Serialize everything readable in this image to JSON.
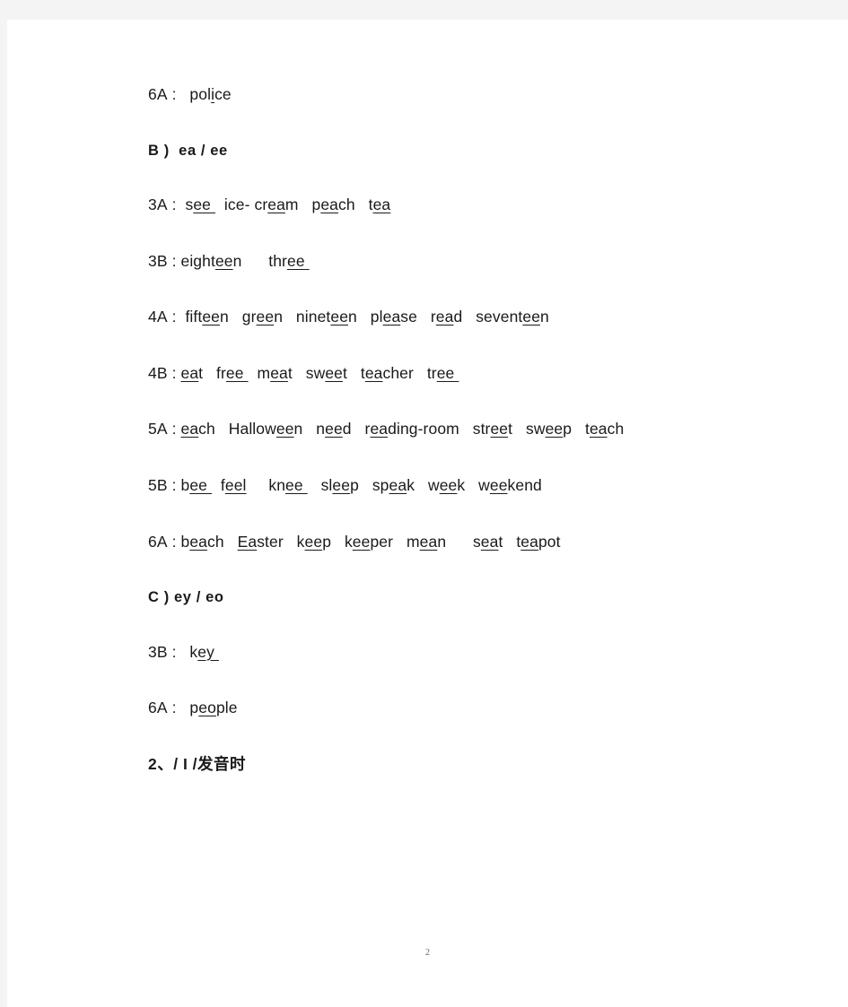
{
  "page": {
    "number": "2",
    "background_color": "#f4f4f4",
    "paper_color": "#ffffff",
    "text_color": "#1a1a1a"
  },
  "blocks": [
    {
      "id": "line-6a-police",
      "type": "entry",
      "label": "6A :",
      "text": "police",
      "segments": [
        {
          "t": "6A :",
          "u": false
        },
        {
          "t": "   ",
          "u": false
        },
        {
          "t": "pol",
          "u": false
        },
        {
          "t": "i",
          "u": true
        },
        {
          "t": "ce",
          "u": false
        }
      ]
    },
    {
      "id": "heading-b",
      "type": "heading",
      "text": "B ) ea / ee",
      "segments": [
        {
          "t": "B )",
          "u": false
        },
        {
          "t": "  ",
          "u": false
        },
        {
          "t": "ea / ee",
          "u": false
        }
      ]
    },
    {
      "id": "line-3a-ea-ee",
      "type": "entry",
      "label": "3A :",
      "text": "see  ice- cream  peach  tea",
      "segments": [
        {
          "t": "3A :",
          "u": false
        },
        {
          "t": "  ",
          "u": false
        },
        {
          "t": "s",
          "u": false
        },
        {
          "t": "ee ",
          "u": true
        },
        {
          "t": "  ",
          "u": false
        },
        {
          "t": "ice- cr",
          "u": false
        },
        {
          "t": "ea",
          "u": true
        },
        {
          "t": "m",
          "u": false
        },
        {
          "t": "   ",
          "u": false
        },
        {
          "t": "p",
          "u": false
        },
        {
          "t": "ea",
          "u": true
        },
        {
          "t": "ch",
          "u": false
        },
        {
          "t": "   ",
          "u": false
        },
        {
          "t": "t",
          "u": false
        },
        {
          "t": "ea",
          "u": true
        }
      ]
    },
    {
      "id": "line-3b-ea-ee",
      "type": "entry",
      "label": "3B :",
      "text": "eighteen   three",
      "segments": [
        {
          "t": "3B : eight",
          "u": false
        },
        {
          "t": "ee",
          "u": true
        },
        {
          "t": "n",
          "u": false
        },
        {
          "t": "      ",
          "u": false
        },
        {
          "t": "thr",
          "u": false
        },
        {
          "t": "ee ",
          "u": true
        }
      ]
    },
    {
      "id": "line-4a-ea-ee",
      "type": "entry",
      "label": "4A :",
      "text": "fifteen  green  nineteen  please  read  seventeen",
      "segments": [
        {
          "t": "4A :",
          "u": false
        },
        {
          "t": "  ",
          "u": false
        },
        {
          "t": "fift",
          "u": false
        },
        {
          "t": "ee",
          "u": true
        },
        {
          "t": "n",
          "u": false
        },
        {
          "t": "   ",
          "u": false
        },
        {
          "t": "gr",
          "u": false
        },
        {
          "t": "ee",
          "u": true
        },
        {
          "t": "n",
          "u": false
        },
        {
          "t": "   ",
          "u": false
        },
        {
          "t": "ninet",
          "u": false
        },
        {
          "t": "ee",
          "u": true
        },
        {
          "t": "n",
          "u": false
        },
        {
          "t": "   ",
          "u": false
        },
        {
          "t": "pl",
          "u": false
        },
        {
          "t": "ea",
          "u": true
        },
        {
          "t": "se",
          "u": false
        },
        {
          "t": "   ",
          "u": false
        },
        {
          "t": "r",
          "u": false
        },
        {
          "t": "ea",
          "u": true
        },
        {
          "t": "d",
          "u": false
        },
        {
          "t": "   ",
          "u": false
        },
        {
          "t": "sevent",
          "u": false
        },
        {
          "t": "ee",
          "u": true
        },
        {
          "t": "n",
          "u": false
        }
      ]
    },
    {
      "id": "line-4b-ea-ee",
      "type": "entry",
      "label": "4B :",
      "text": "eat  free  meat  sweet  teacher  tree",
      "segments": [
        {
          "t": "4B : ",
          "u": false
        },
        {
          "t": "ea",
          "u": true
        },
        {
          "t": "t",
          "u": false
        },
        {
          "t": "   ",
          "u": false
        },
        {
          "t": "fr",
          "u": false
        },
        {
          "t": "ee ",
          "u": true
        },
        {
          "t": "  ",
          "u": false
        },
        {
          "t": "m",
          "u": false
        },
        {
          "t": "ea",
          "u": true
        },
        {
          "t": "t",
          "u": false
        },
        {
          "t": "   ",
          "u": false
        },
        {
          "t": "sw",
          "u": false
        },
        {
          "t": "ee",
          "u": true
        },
        {
          "t": "t",
          "u": false
        },
        {
          "t": "   ",
          "u": false
        },
        {
          "t": "t",
          "u": false
        },
        {
          "t": "ea",
          "u": true
        },
        {
          "t": "cher",
          "u": false
        },
        {
          "t": "   ",
          "u": false
        },
        {
          "t": "tr",
          "u": false
        },
        {
          "t": "ee ",
          "u": true
        }
      ]
    },
    {
      "id": "line-5a-ea-ee",
      "type": "entry",
      "label": "5A :",
      "text": "each  Halloween  need  reading-room  street  sweep  teach",
      "segments": [
        {
          "t": "5A : ",
          "u": false
        },
        {
          "t": "ea",
          "u": true
        },
        {
          "t": "ch",
          "u": false
        },
        {
          "t": "   ",
          "u": false
        },
        {
          "t": "Hallow",
          "u": false
        },
        {
          "t": "ee",
          "u": true
        },
        {
          "t": "n",
          "u": false
        },
        {
          "t": "   ",
          "u": false
        },
        {
          "t": "n",
          "u": false
        },
        {
          "t": "ee",
          "u": true
        },
        {
          "t": "d",
          "u": false
        },
        {
          "t": "   ",
          "u": false
        },
        {
          "t": "r",
          "u": false
        },
        {
          "t": "ea",
          "u": true
        },
        {
          "t": "ding-room",
          "u": false
        },
        {
          "t": "   ",
          "u": false
        },
        {
          "t": "str",
          "u": false
        },
        {
          "t": "ee",
          "u": true
        },
        {
          "t": "t",
          "u": false
        },
        {
          "t": "   ",
          "u": false
        },
        {
          "t": "sw",
          "u": false
        },
        {
          "t": "ee",
          "u": true
        },
        {
          "t": "p",
          "u": false
        },
        {
          "t": "   ",
          "u": false
        },
        {
          "t": "t",
          "u": false
        },
        {
          "t": "ea",
          "u": true
        },
        {
          "t": "ch",
          "u": false
        }
      ]
    },
    {
      "id": "line-5b-ea-ee",
      "type": "entry",
      "label": "5B :",
      "text": "bee  feel   knee  sleep  speak  week  weekend",
      "segments": [
        {
          "t": "5B : ",
          "u": false
        },
        {
          "t": "b",
          "u": false
        },
        {
          "t": "ee ",
          "u": true
        },
        {
          "t": "  ",
          "u": false
        },
        {
          "t": "f",
          "u": false
        },
        {
          "t": "eel",
          "u": true
        },
        {
          "t": "     ",
          "u": false
        },
        {
          "t": "kn",
          "u": false
        },
        {
          "t": "ee ",
          "u": true
        },
        {
          "t": "   ",
          "u": false
        },
        {
          "t": "sl",
          "u": false
        },
        {
          "t": "ee",
          "u": true
        },
        {
          "t": "p",
          "u": false
        },
        {
          "t": "   ",
          "u": false
        },
        {
          "t": "sp",
          "u": false
        },
        {
          "t": "ea",
          "u": true
        },
        {
          "t": "k",
          "u": false
        },
        {
          "t": "   ",
          "u": false
        },
        {
          "t": "w",
          "u": false
        },
        {
          "t": "ee",
          "u": true
        },
        {
          "t": "k",
          "u": false
        },
        {
          "t": "   ",
          "u": false
        },
        {
          "t": "w",
          "u": false
        },
        {
          "t": "ee",
          "u": true
        },
        {
          "t": "kend",
          "u": false
        }
      ]
    },
    {
      "id": "line-6a-ea-ee",
      "type": "entry",
      "label": "6A :",
      "text": "beach  Easter  keep  keeper  mean   seat  teapot",
      "segments": [
        {
          "t": "6A : ",
          "u": false
        },
        {
          "t": "b",
          "u": false
        },
        {
          "t": "ea",
          "u": true
        },
        {
          "t": "ch",
          "u": false
        },
        {
          "t": "   ",
          "u": false
        },
        {
          "t": "Ea",
          "u": true
        },
        {
          "t": "ster",
          "u": false
        },
        {
          "t": "   ",
          "u": false
        },
        {
          "t": "k",
          "u": false
        },
        {
          "t": "ee",
          "u": true
        },
        {
          "t": "p",
          "u": false
        },
        {
          "t": "   ",
          "u": false
        },
        {
          "t": "k",
          "u": false
        },
        {
          "t": "ee",
          "u": true
        },
        {
          "t": "per",
          "u": false
        },
        {
          "t": "   ",
          "u": false
        },
        {
          "t": "m",
          "u": false
        },
        {
          "t": "ea",
          "u": true
        },
        {
          "t": "n",
          "u": false
        },
        {
          "t": "      ",
          "u": false
        },
        {
          "t": "s",
          "u": false
        },
        {
          "t": "ea",
          "u": true
        },
        {
          "t": "t",
          "u": false
        },
        {
          "t": "   ",
          "u": false
        },
        {
          "t": "t",
          "u": false
        },
        {
          "t": "ea",
          "u": true
        },
        {
          "t": "pot",
          "u": false
        }
      ]
    },
    {
      "id": "heading-c",
      "type": "heading",
      "text": "C ) ey / eo",
      "segments": [
        {
          "t": "C )",
          "u": false
        },
        {
          "t": " ",
          "u": false
        },
        {
          "t": "ey / eo",
          "u": false
        }
      ]
    },
    {
      "id": "line-3b-ey-eo",
      "type": "entry",
      "label": "3B :",
      "text": "key",
      "segments": [
        {
          "t": "3B :",
          "u": false
        },
        {
          "t": "   ",
          "u": false
        },
        {
          "t": "k",
          "u": false
        },
        {
          "t": "ey ",
          "u": true
        }
      ]
    },
    {
      "id": "line-6a-ey-eo",
      "type": "entry",
      "label": "6A :",
      "text": "people",
      "segments": [
        {
          "t": "6A :",
          "u": false
        },
        {
          "t": "   ",
          "u": false
        },
        {
          "t": "p",
          "u": false
        },
        {
          "t": "eo",
          "u": true
        },
        {
          "t": "ple",
          "u": false
        }
      ]
    },
    {
      "id": "heading-section-2",
      "type": "heading-cn",
      "text": "2、/ I /发音时",
      "segments": [
        {
          "t": "2、/ I /发音时",
          "u": false
        }
      ]
    }
  ]
}
